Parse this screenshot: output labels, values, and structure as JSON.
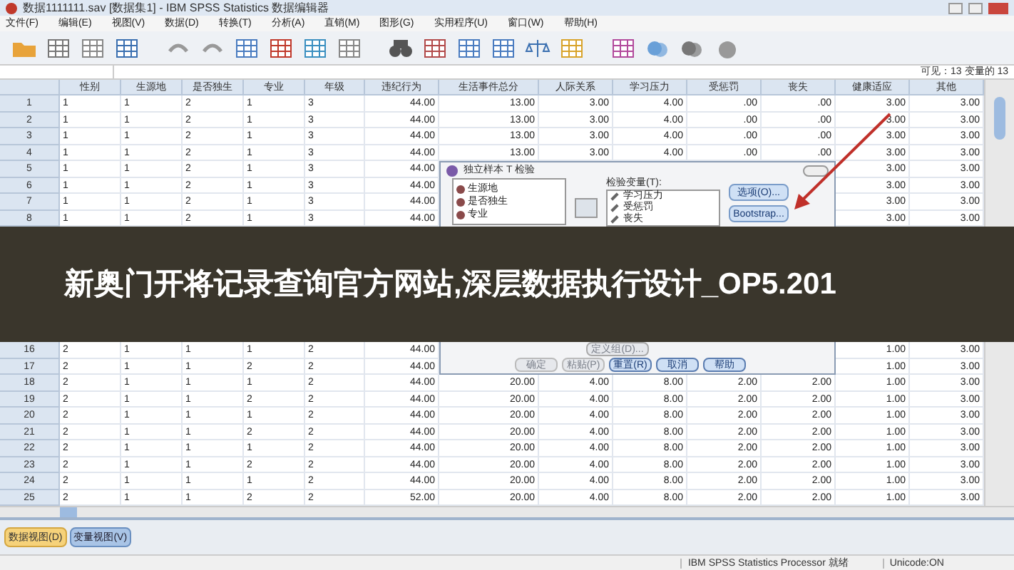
{
  "window": {
    "title": "数据1111111.sav [数据集1] - IBM SPSS Statistics 数据编辑器"
  },
  "menu": [
    "文件(F)",
    "编辑(E)",
    "视图(V)",
    "数据(D)",
    "转换(T)",
    "分析(A)",
    "直销(M)",
    "图形(G)",
    "实用程序(U)",
    "窗口(W)",
    "帮助(H)"
  ],
  "visible_count": "可见：13 变量的 13",
  "table": {
    "columns": [
      "性别",
      "生源地",
      "是否独生",
      "专业",
      "年级",
      "违纪行为",
      "生活事件总分",
      "人际关系",
      "学习压力",
      "受惩罚",
      "丧失",
      "健康适应",
      "其他"
    ],
    "rows_top": [
      {
        "num": "1",
        "cells": [
          "1",
          "1",
          "2",
          "1",
          "3",
          "44.00",
          "13.00",
          "3.00",
          "4.00",
          ".00",
          ".00",
          "3.00",
          "3.00"
        ]
      },
      {
        "num": "2",
        "cells": [
          "1",
          "1",
          "2",
          "1",
          "3",
          "44.00",
          "13.00",
          "3.00",
          "4.00",
          ".00",
          ".00",
          "3.00",
          "3.00"
        ]
      },
      {
        "num": "3",
        "cells": [
          "1",
          "1",
          "2",
          "1",
          "3",
          "44.00",
          "13.00",
          "3.00",
          "4.00",
          ".00",
          ".00",
          "3.00",
          "3.00"
        ]
      },
      {
        "num": "4",
        "cells": [
          "1",
          "1",
          "2",
          "1",
          "3",
          "44.00",
          "13.00",
          "3.00",
          "4.00",
          ".00",
          ".00",
          "3.00",
          "3.00"
        ]
      },
      {
        "num": "5",
        "cells": [
          "1",
          "1",
          "2",
          "1",
          "3",
          "44.00",
          null,
          null,
          null,
          null,
          null,
          "3.00",
          "3.00"
        ]
      },
      {
        "num": "6",
        "cells": [
          "1",
          "1",
          "2",
          "1",
          "3",
          "44.00",
          null,
          null,
          null,
          null,
          null,
          "3.00",
          "3.00"
        ]
      },
      {
        "num": "7",
        "cells": [
          "1",
          "1",
          "2",
          "1",
          "3",
          "44.00",
          null,
          null,
          null,
          null,
          null,
          "3.00",
          "3.00"
        ]
      },
      {
        "num": "8",
        "cells": [
          "1",
          "1",
          "2",
          "1",
          "3",
          "44.00",
          null,
          null,
          null,
          null,
          null,
          "3.00",
          "3.00"
        ]
      }
    ],
    "rows_bottom": [
      {
        "num": "16",
        "cells": [
          "2",
          "1",
          "1",
          "1",
          "2",
          "44.00",
          null,
          null,
          null,
          null,
          null,
          "1.00",
          "3.00"
        ]
      },
      {
        "num": "17",
        "cells": [
          "2",
          "1",
          "1",
          "2",
          "2",
          "44.00",
          null,
          null,
          null,
          null,
          null,
          "1.00",
          "3.00"
        ]
      },
      {
        "num": "18",
        "cells": [
          "2",
          "1",
          "1",
          "1",
          "2",
          "44.00",
          "20.00",
          "4.00",
          "8.00",
          "2.00",
          "2.00",
          "1.00",
          "3.00"
        ]
      },
      {
        "num": "19",
        "cells": [
          "2",
          "1",
          "1",
          "2",
          "2",
          "44.00",
          "20.00",
          "4.00",
          "8.00",
          "2.00",
          "2.00",
          "1.00",
          "3.00"
        ]
      },
      {
        "num": "20",
        "cells": [
          "2",
          "1",
          "1",
          "1",
          "2",
          "44.00",
          "20.00",
          "4.00",
          "8.00",
          "2.00",
          "2.00",
          "1.00",
          "3.00"
        ]
      },
      {
        "num": "21",
        "cells": [
          "2",
          "1",
          "1",
          "2",
          "2",
          "44.00",
          "20.00",
          "4.00",
          "8.00",
          "2.00",
          "2.00",
          "1.00",
          "3.00"
        ]
      },
      {
        "num": "22",
        "cells": [
          "2",
          "1",
          "1",
          "1",
          "2",
          "44.00",
          "20.00",
          "4.00",
          "8.00",
          "2.00",
          "2.00",
          "1.00",
          "3.00"
        ]
      },
      {
        "num": "23",
        "cells": [
          "2",
          "1",
          "1",
          "2",
          "2",
          "44.00",
          "20.00",
          "4.00",
          "8.00",
          "2.00",
          "2.00",
          "1.00",
          "3.00"
        ]
      },
      {
        "num": "24",
        "cells": [
          "2",
          "1",
          "1",
          "1",
          "2",
          "44.00",
          "20.00",
          "4.00",
          "8.00",
          "2.00",
          "2.00",
          "1.00",
          "3.00"
        ]
      },
      {
        "num": "25",
        "cells": [
          "2",
          "1",
          "1",
          "2",
          "2",
          "52.00",
          "20.00",
          "4.00",
          "8.00",
          "2.00",
          "2.00",
          "1.00",
          "3.00"
        ]
      }
    ]
  },
  "dialog": {
    "title": "独立样本 T 检验",
    "source_vars": [
      "生源地",
      "是否独生",
      "专业"
    ],
    "test_label": "检验变量(T):",
    "test_vars": [
      "学习压力",
      "受惩罚",
      "丧失"
    ],
    "side_buttons": [
      "选项(O)...",
      "Bootstrap..."
    ],
    "define_button": {
      "label": "定义组(D)...",
      "disabled": true
    },
    "buttons": [
      {
        "label": "确定",
        "disabled": true
      },
      {
        "label": "粘贴(P)",
        "disabled": true
      },
      {
        "label": "重置(R)",
        "disabled": false
      },
      {
        "label": "取消",
        "disabled": false
      },
      {
        "label": "帮助",
        "disabled": false
      }
    ]
  },
  "view_tabs": [
    {
      "label": "数据视图(D)",
      "selected": true
    },
    {
      "label": "变量视图(V)",
      "selected": false
    }
  ],
  "status_bar": [
    "IBM SPSS Statistics Processor 就绪",
    "Unicode:ON"
  ],
  "banner": "新奥门开将记录查询官方网站,深层数据执行设计_OP5.201"
}
